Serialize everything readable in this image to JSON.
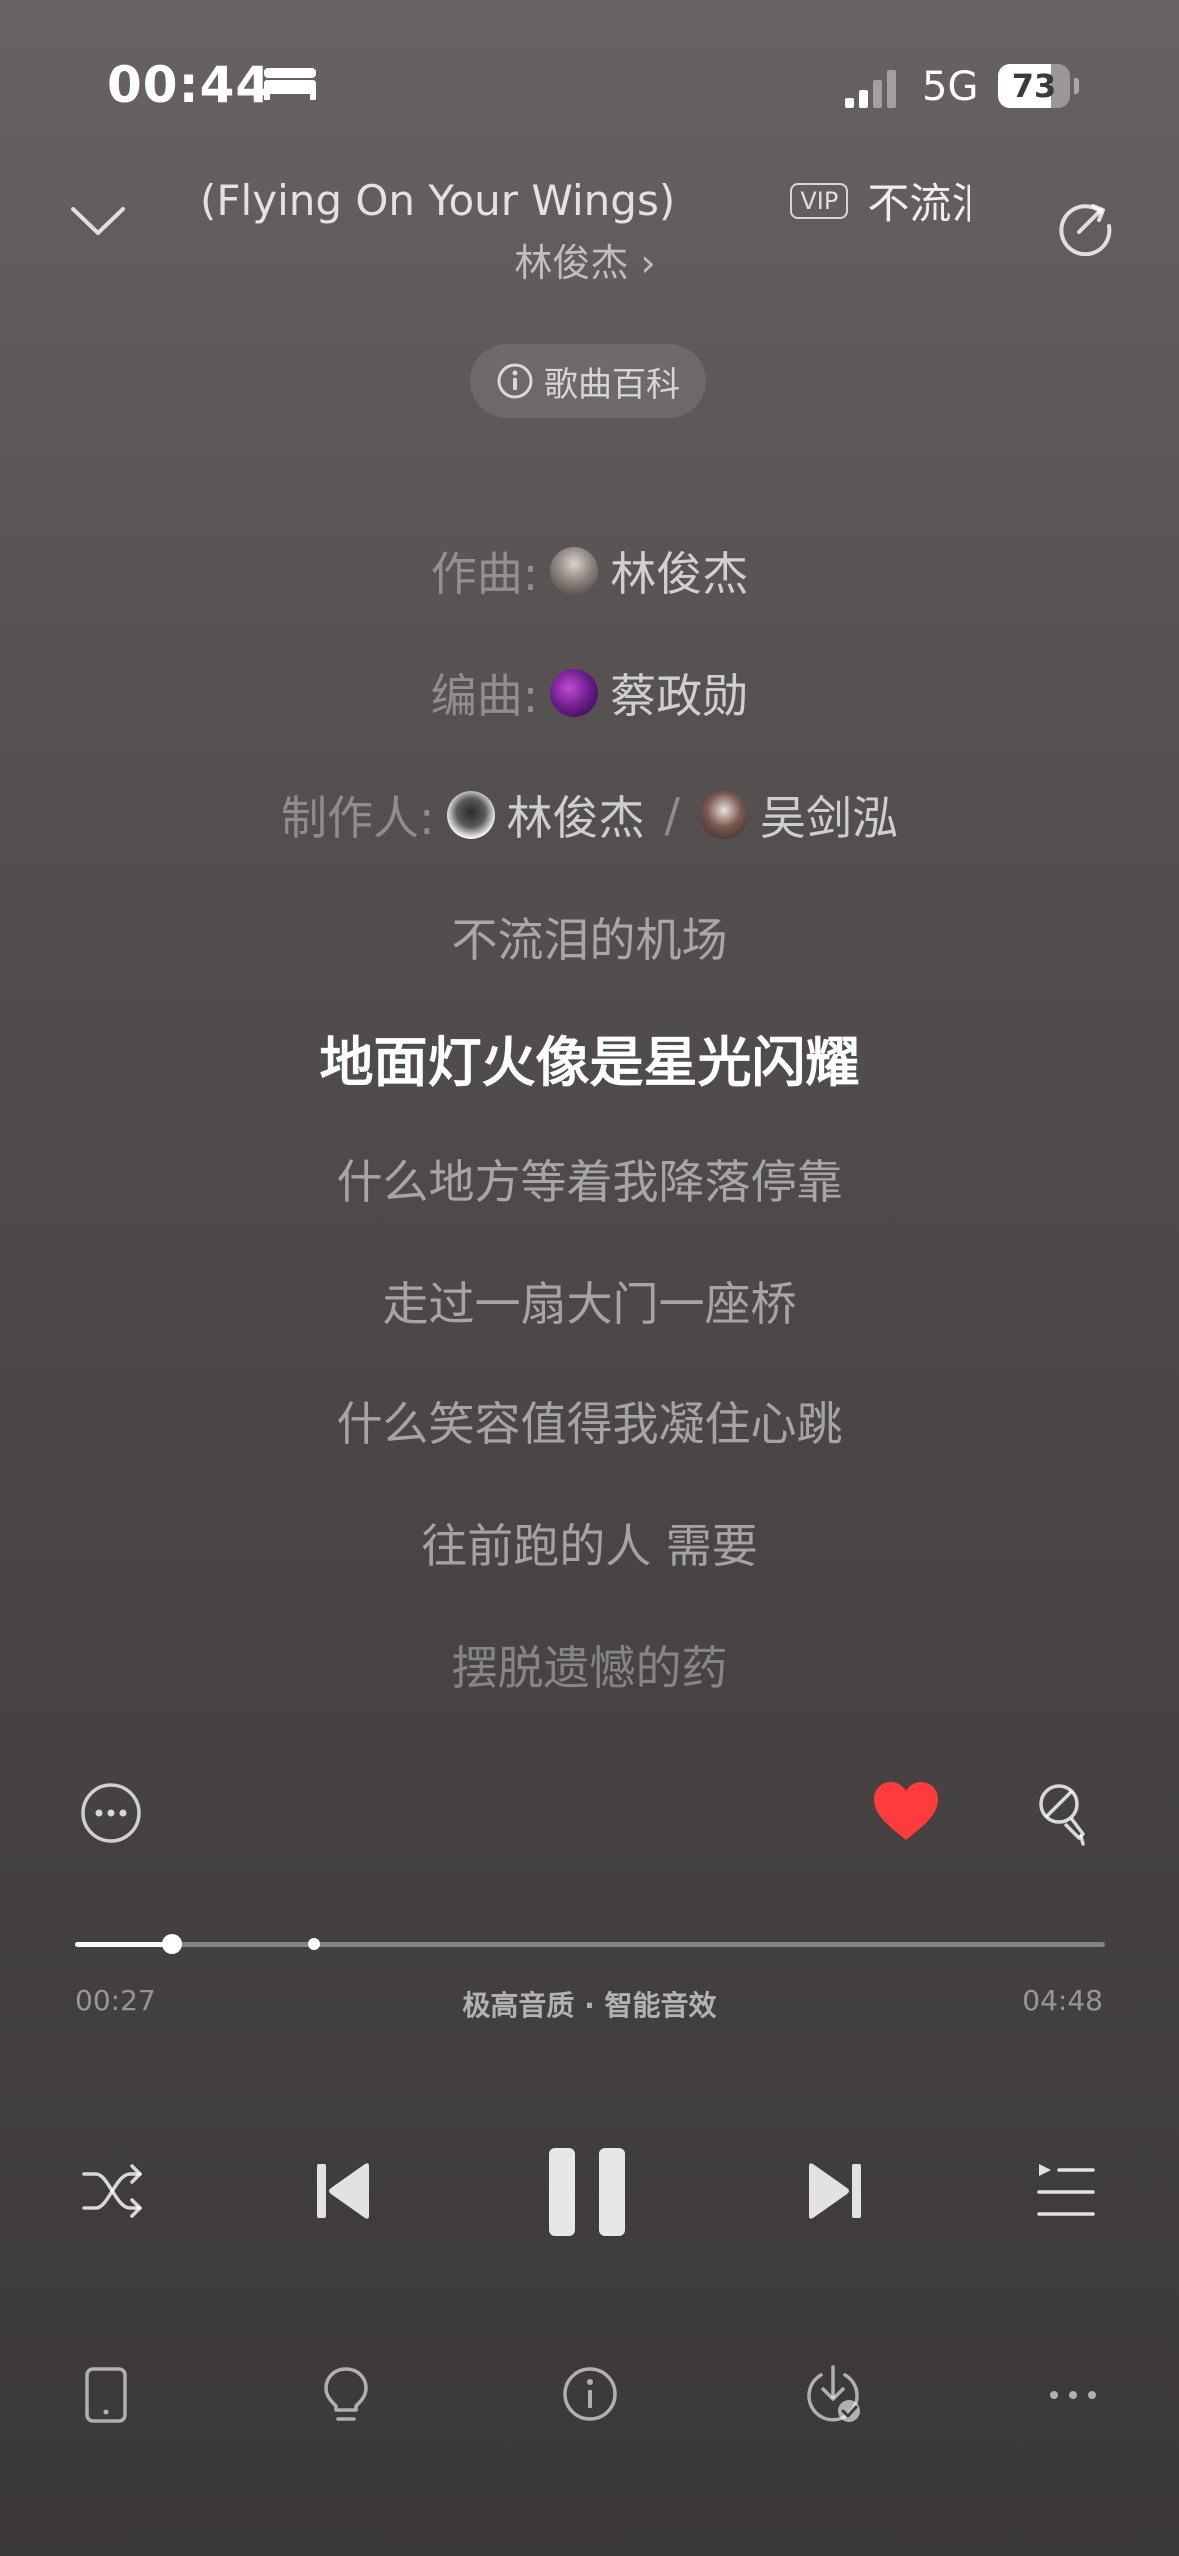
{
  "status_bar": {
    "time": "00:44",
    "network": "5G",
    "battery": "73",
    "battery_level": 0.73,
    "icons": [
      "bed-icon",
      "signal-icon"
    ]
  },
  "header": {
    "title": "(Flying On Your Wings)",
    "vip_badge": "VIP",
    "title_second": "不流泪",
    "artist": "林俊杰 ›",
    "icons": [
      "chevron-down-icon",
      "share-icon"
    ]
  },
  "wiki_button": {
    "label": "歌曲百科",
    "icon": "info-icon"
  },
  "credits": {
    "composer_label": "作曲:",
    "composer": "林俊杰",
    "arranger_label": "编曲:",
    "arranger": "蔡政勋",
    "producer_label": "制作人:",
    "producer_1": "林俊杰",
    "separator": "/",
    "producer_2": "吴剑泓"
  },
  "lyrics": {
    "lines": [
      "不流泪的机场",
      "地面灯火像是星光闪耀",
      "什么地方等着我降落停靠",
      "走过一扇大门一座桥",
      "什么笑容值得我凝住心跳",
      "往前跑的人 需要",
      "摆脱遗憾的药"
    ],
    "current_index": 1
  },
  "actions": {
    "icons": [
      "more-circle-icon",
      "heart-icon",
      "mic-icon"
    ],
    "liked_color": "#ff3b3b"
  },
  "playback": {
    "elapsed": "00:27",
    "total": "04:48",
    "progress": 0.094,
    "buffered": 0.24,
    "quality": "极高音质 · 智能音效"
  },
  "controls": {
    "icons": [
      "shuffle-icon",
      "previous-icon",
      "pause-icon",
      "next-icon",
      "queue-icon"
    ]
  },
  "toolbar": {
    "icons": [
      "device-icon",
      "lightbulb-icon",
      "info-icon",
      "download-icon",
      "more-dots-icon"
    ]
  }
}
